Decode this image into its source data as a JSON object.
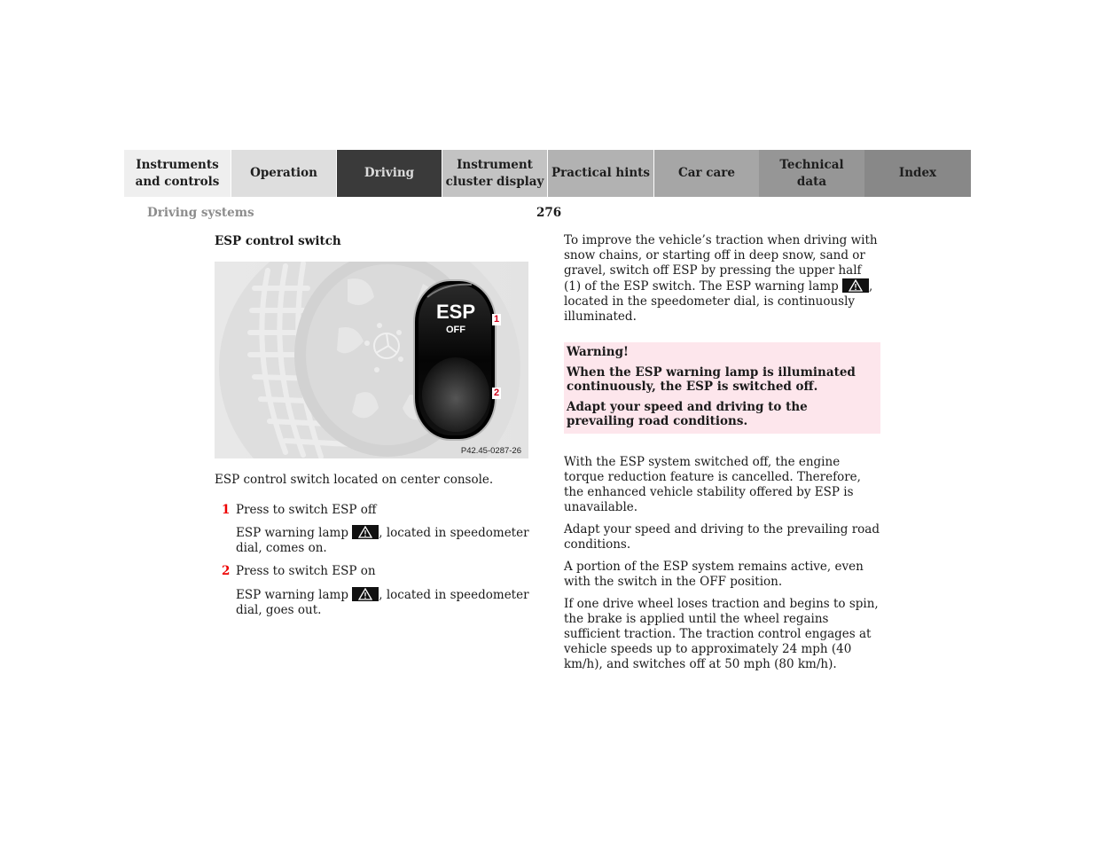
{
  "nav": {
    "tabs": [
      {
        "label": "Instruments\nand controls",
        "active": false
      },
      {
        "label": "Operation",
        "active": false
      },
      {
        "label": "Driving",
        "active": true
      },
      {
        "label": "Instrument\ncluster display",
        "active": false
      },
      {
        "label": "Practical hints",
        "active": false
      },
      {
        "label": "Car care",
        "active": false
      },
      {
        "label": "Technical\ndata",
        "active": false
      },
      {
        "label": "Index",
        "active": false
      }
    ]
  },
  "header": {
    "section_title": "Driving systems",
    "page_number": "276"
  },
  "left": {
    "heading": "ESP control switch",
    "figure": {
      "switch_label_top": "ESP",
      "switch_label_bottom": "OFF",
      "callout_1": "1",
      "callout_2": "2",
      "code": "P42.45-0287-26",
      "icon": "esp-switch-illustration"
    },
    "caption": "ESP control switch located on center console.",
    "steps": [
      {
        "num": "1",
        "text": "Press to switch ESP off",
        "detail_before": "ESP warning lamp ",
        "detail_icon": "warning-triangle-icon",
        "detail_after": ", located in speedometer dial, comes on."
      },
      {
        "num": "2",
        "text": "Press to switch ESP on",
        "detail_before": "ESP warning lamp ",
        "detail_icon": "warning-triangle-icon",
        "detail_after": ", located in speedometer dial, goes out."
      }
    ]
  },
  "right": {
    "intro_before": "To improve the vehicle’s traction when driving with snow chains, or starting off in deep snow, sand or gravel, switch off ESP by pressing the upper half (1) of the ESP switch. The ESP warning lamp ",
    "intro_after": ", located in the speedometer dial, is continuously illuminated.",
    "warning": {
      "title": "Warning!",
      "lines": [
        "When the ESP warning lamp is illuminated continuously, the ESP is switched off.",
        "Adapt your speed and driving to the prevailing road conditions."
      ],
      "background": "#fde6ec"
    },
    "paragraphs": [
      "With the ESP system switched off, the engine torque reduction feature is cancelled. Therefore, the enhanced vehicle stability offered by ESP is unavailable.",
      "Adapt your speed and driving to the prevailing road conditions.",
      "A portion of the ESP system remains active, even with the switch in the OFF position.",
      "If one drive wheel loses traction and begins to spin, the brake is applied until the wheel regains sufficient traction. The traction control engages at vehicle speeds up to approximately 24 mph (40 km/h), and switches off at 50 mph (80 km/h)."
    ]
  },
  "colors": {
    "active_tab": "#3a3a3a",
    "step_number": "#e00000",
    "callout": "#d0021b"
  }
}
